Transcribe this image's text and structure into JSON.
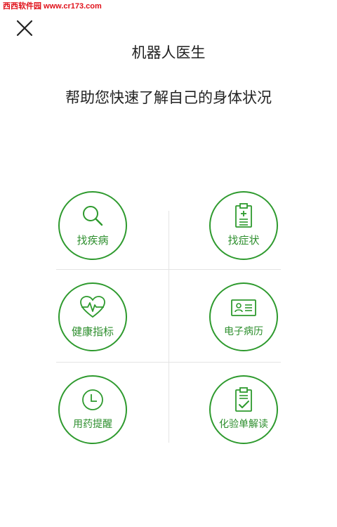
{
  "watermark": "西西软件园 www.cr173.com",
  "header": {
    "title": "机器人医生",
    "subtitle": "帮助您快速了解自己的身体状况",
    "close_icon": "close-icon"
  },
  "colors": {
    "accent": "#2e9a2e",
    "divider": "#e4e4e4",
    "text": "#222222",
    "watermark": "#e0111a"
  },
  "features": [
    {
      "label": "找疾病",
      "icon": "search-icon"
    },
    {
      "label": "找症状",
      "icon": "clipboard-plus-icon"
    },
    {
      "label": "健康指标",
      "icon": "heart-pulse-icon"
    },
    {
      "label": "电子病历",
      "icon": "id-card-icon"
    },
    {
      "label": "用药提醒",
      "icon": "clock-icon"
    },
    {
      "label": "化验单解读",
      "icon": "clipboard-check-icon"
    }
  ]
}
